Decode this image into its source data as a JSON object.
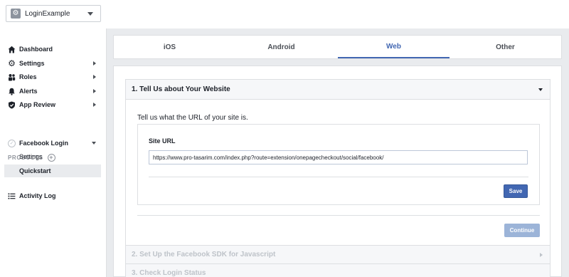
{
  "app_selector": {
    "name": "LoginExample"
  },
  "sidebar": {
    "items": [
      {
        "label": "Dashboard",
        "icon": "home-icon"
      },
      {
        "label": "Settings",
        "icon": "gear-icon"
      },
      {
        "label": "Roles",
        "icon": "roles-icon"
      },
      {
        "label": "Alerts",
        "icon": "bell-icon"
      },
      {
        "label": "App Review",
        "icon": "shield-check-icon"
      }
    ],
    "products_heading": "PRODUCTS",
    "product": {
      "label": "Facebook Login",
      "icon": "check-circle-icon"
    },
    "sub_items": [
      {
        "label": "Settings"
      },
      {
        "label": "Quickstart",
        "active": true
      }
    ],
    "activity_log": {
      "label": "Activity Log",
      "icon": "list-icon"
    }
  },
  "tabs": [
    {
      "label": "iOS"
    },
    {
      "label": "Android"
    },
    {
      "label": "Web",
      "active": true
    },
    {
      "label": "Other"
    }
  ],
  "step1": {
    "title": "1. Tell Us about Your Website",
    "intro": "Tell us what the URL of your site is.",
    "site_url_label": "Site URL",
    "site_url_value": "https://www.pro-tasarim.com/index.php?route=extension/onepagecheckout/social/facebook/",
    "save_label": "Save",
    "continue_label": "Continue"
  },
  "step2": {
    "title": "2. Set Up the Facebook SDK for Javascript"
  },
  "step3": {
    "title": "3. Check Login Status"
  },
  "colors": {
    "accent": "#4267b2",
    "disabled_button": "#9cb4d8",
    "background": "#e9ebee"
  }
}
